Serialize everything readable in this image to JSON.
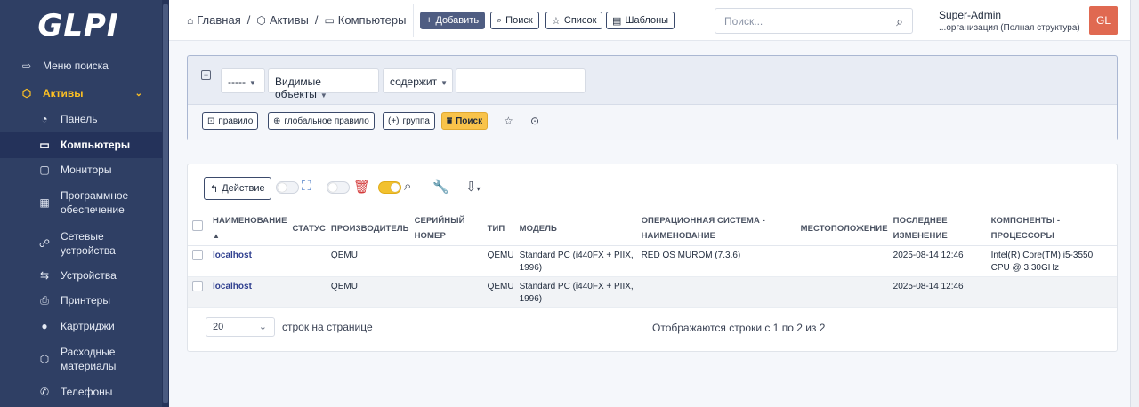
{
  "sidebar": {
    "logo": "GLPI",
    "items": [
      {
        "label": "Меню поиска",
        "icon": "arrow-right-icon"
      },
      {
        "label": "Активы",
        "icon": "cube-icon"
      },
      {
        "label": "Панель",
        "icon": "dashboard-icon"
      },
      {
        "label": "Компьютеры",
        "icon": "laptop-icon"
      },
      {
        "label": "Мониторы",
        "icon": "monitor-icon"
      },
      {
        "label": "Программное обеспечение",
        "icon": "apps-icon"
      },
      {
        "label": "Сетевые устройства",
        "icon": "network-icon"
      },
      {
        "label": "Устройства",
        "icon": "usb-icon"
      },
      {
        "label": "Принтеры",
        "icon": "printer-icon"
      },
      {
        "label": "Картриджи",
        "icon": "droplet-icon"
      },
      {
        "label": "Расходные материалы",
        "icon": "package-icon"
      },
      {
        "label": "Телефоны",
        "icon": "phone-icon"
      }
    ]
  },
  "header": {
    "breadcrumb": [
      "Главная",
      "Активы",
      "Компьютеры"
    ],
    "buttons": {
      "add": "Добавить",
      "search": "Поиск",
      "list": "Список",
      "templates": "Шаблоны"
    },
    "search_placeholder": "Поиск...",
    "user_name": "Super-Admin",
    "user_entity": "...организация (Полная структура)",
    "avatar_initials": "GL"
  },
  "criteria": {
    "field1": "-----",
    "field2": "Видимые объекты",
    "field3": "содержит",
    "value": "",
    "buttons": {
      "rule": "правило",
      "global_rule": "глобальное правило",
      "group": "группа",
      "search": "Поиск"
    }
  },
  "results": {
    "action_label": "Действие",
    "columns": [
      "НАИМЕНОВАНИЕ",
      "СТАТУС",
      "ПРОИЗВОДИТЕЛЬ",
      "СЕРИЙНЫЙ НОМЕР",
      "ТИП",
      "МОДЕЛЬ",
      "ОПЕРАЦИОННАЯ СИСТЕМА - НАИМЕНОВАНИЕ",
      "МЕСТОПОЛОЖЕНИЕ",
      "ПОСЛЕДНЕЕ ИЗМЕНЕНИЕ",
      "КОМПОНЕНТЫ - ПРОЦЕССОРЫ"
    ],
    "rows": [
      {
        "name": "localhost",
        "status": "",
        "manufacturer": "QEMU",
        "serial": "",
        "type": "QEMU",
        "model": "Standard PC (i440FX + PIIX, 1996)",
        "os": "RED OS MUROM (7.3.6)",
        "location": "",
        "modified": "2025-08-14 12:46",
        "cpu": "Intel(R) Core(TM) i5-3550 CPU @ 3.30GHz"
      },
      {
        "name": "localhost",
        "status": "",
        "manufacturer": "QEMU",
        "serial": "",
        "type": "QEMU",
        "model": "Standard PC (i440FX + PIIX, 1996)",
        "os": "",
        "location": "",
        "modified": "2025-08-14 12:46",
        "cpu": ""
      }
    ],
    "page_size": "20",
    "page_size_label": "строк на странице",
    "pager_info": "Отображаются строки с 1 по 2 из 2"
  }
}
